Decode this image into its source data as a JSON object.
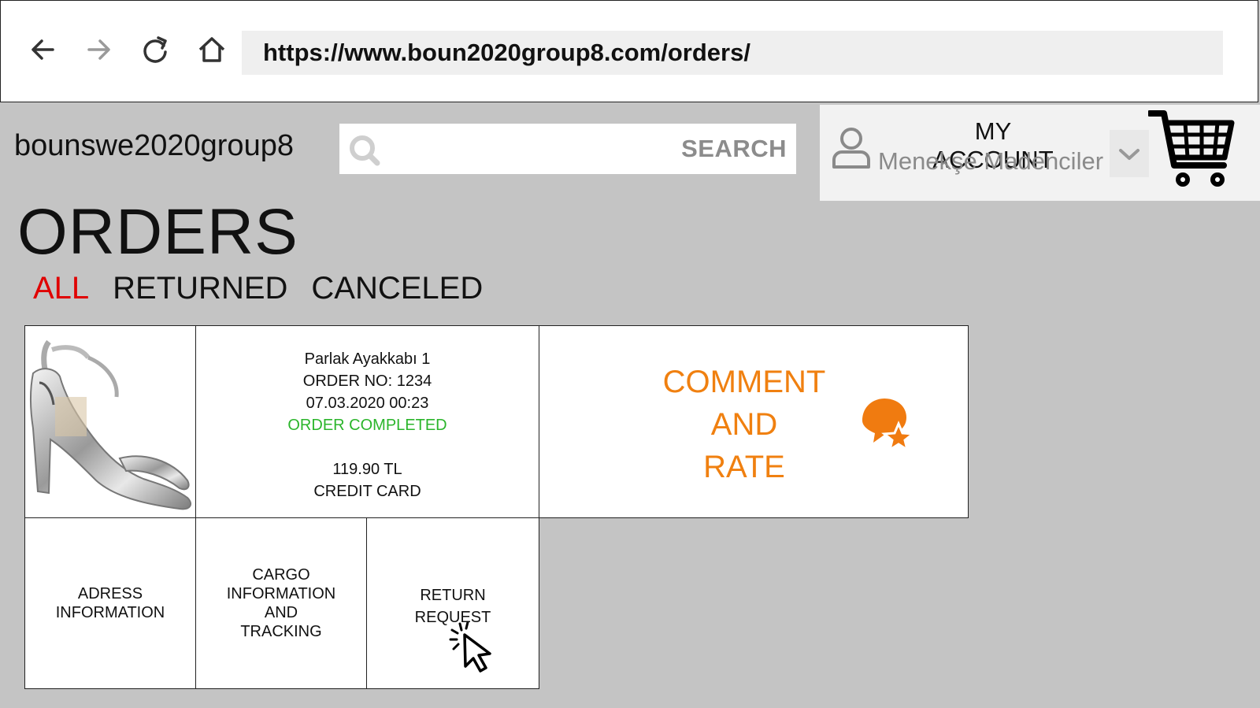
{
  "browser": {
    "url": "https://www.boun2020group8.com/orders/",
    "nav_icons": [
      "back-arrow-icon",
      "forward-arrow-icon",
      "refresh-icon",
      "home-icon"
    ]
  },
  "header": {
    "site_name": "bounswe2020group8",
    "search_label": "SEARCH",
    "account_title": "MY ACCOUNT",
    "account_user": "Menekşe Madenciler"
  },
  "page": {
    "title": "ORDERS",
    "tabs": [
      {
        "label": "ALL",
        "active": true
      },
      {
        "label": "RETURNED",
        "active": false
      },
      {
        "label": "CANCELED",
        "active": false
      }
    ]
  },
  "order": {
    "product_name": "Parlak Ayakkabı 1",
    "order_no": "ORDER NO: 1234",
    "datetime": "07.03.2020 00:23",
    "status": "ORDER COMPLETED",
    "price": "119.90 TL",
    "payment": "CREDIT CARD",
    "comment_rate": [
      "COMMENT",
      "AND",
      "RATE"
    ],
    "actions": {
      "address": [
        "ADRESS",
        "INFORMATION"
      ],
      "cargo": [
        "CARGO",
        "INFORMATION",
        "AND",
        "TRACKING"
      ],
      "return": [
        "RETURN",
        "REQUEST"
      ]
    }
  },
  "colors": {
    "active_tab": "#e00000",
    "status_green": "#2bb52b",
    "comment_orange": "#f08010",
    "background": "#c4c4c4"
  }
}
